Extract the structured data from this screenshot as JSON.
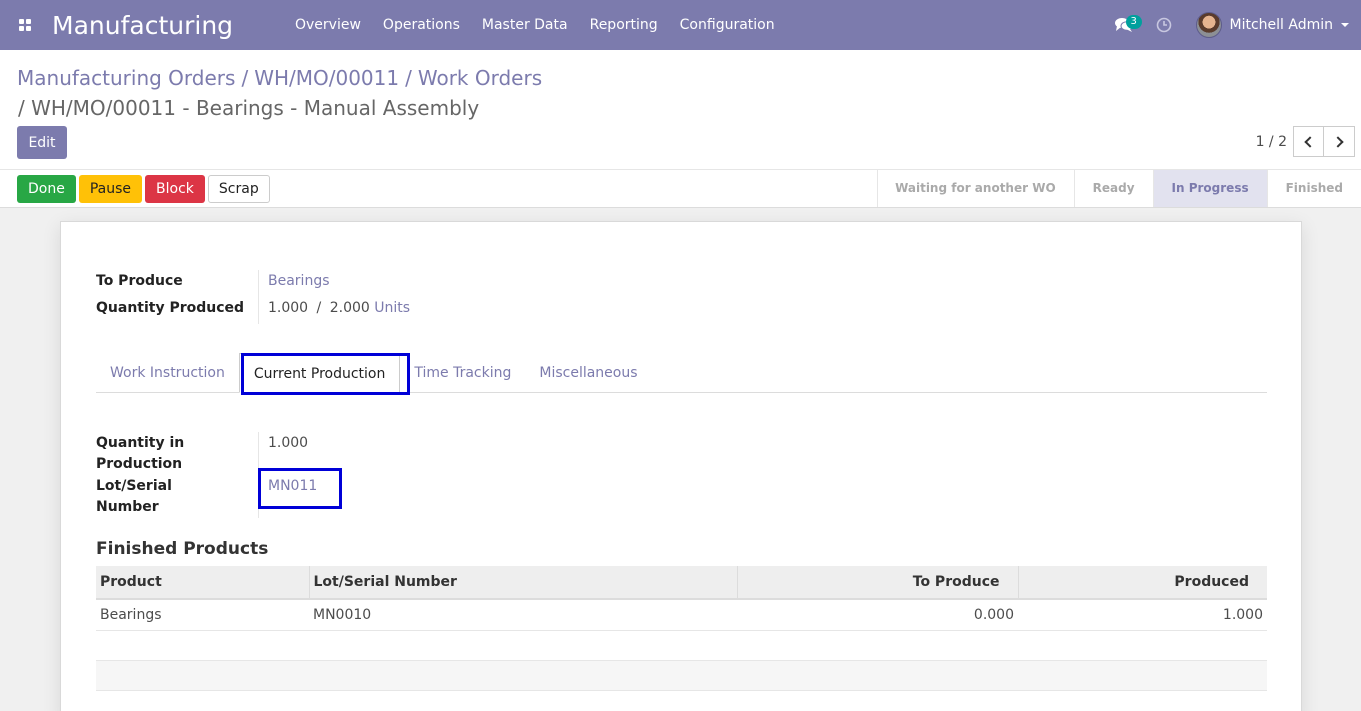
{
  "navbar": {
    "app_title": "Manufacturing",
    "menu": [
      "Overview",
      "Operations",
      "Master Data",
      "Reporting",
      "Configuration"
    ],
    "messages_count": "3",
    "user_name": "Mitchell Admin",
    "icons": {
      "apps": "apps-grid-icon",
      "messages": "comments-icon",
      "activity": "clock-icon"
    },
    "colors": {
      "primary": "#7c7bad",
      "badge": "#00a09d"
    }
  },
  "breadcrumb": {
    "items": [
      "Manufacturing Orders",
      "WH/MO/00011",
      "Work Orders"
    ],
    "separator": "/",
    "current": "/ WH/MO/00011 - Bearings - Manual Assembly"
  },
  "control": {
    "edit_label": "Edit",
    "pager": "1 / 2"
  },
  "actions": {
    "done": "Done",
    "pause": "Pause",
    "block": "Block",
    "scrap": "Scrap"
  },
  "stages": [
    "Waiting for another WO",
    "Ready",
    "In Progress",
    "Finished"
  ],
  "active_stage": "In Progress",
  "form": {
    "to_produce_label": "To Produce",
    "to_produce_value": "Bearings",
    "qty_produced_label": "Quantity Produced",
    "qty_produced_done": "1.000",
    "qty_produced_sep": "/",
    "qty_produced_total": "2.000",
    "qty_produced_uom": "Units"
  },
  "tabs": [
    "Work Instruction",
    "Current Production",
    "Time Tracking",
    "Miscellaneous"
  ],
  "active_tab": "Current Production",
  "current_production": {
    "qty_in_production_label_1": "Quantity in",
    "qty_in_production_label_2": "Production",
    "qty_in_production_value": "1.000",
    "lot_label_1": "Lot/Serial",
    "lot_label_2": "Number",
    "lot_value": "MN011"
  },
  "finished_products": {
    "title": "Finished Products",
    "columns": [
      "Product",
      "Lot/Serial Number",
      "To Produce",
      "Produced"
    ],
    "rows": [
      {
        "product": "Bearings",
        "lot": "MN0010",
        "to_produce": "0.000",
        "produced": "1.000"
      }
    ]
  }
}
